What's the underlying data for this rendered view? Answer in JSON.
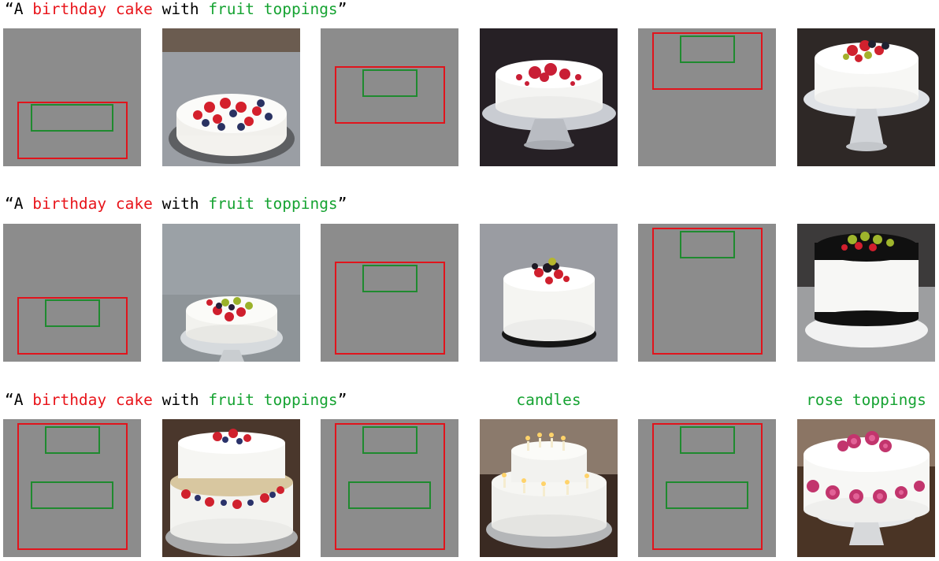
{
  "rows": [
    {
      "caption": {
        "q_open": "“A ",
        "bg": "birthday cake",
        "mid": " with ",
        "fg": "fruit toppings",
        "q_close": "”"
      },
      "labels": [
        "",
        ""
      ]
    },
    {
      "caption": {
        "q_open": "“A ",
        "bg": "birthday cake",
        "mid": " with ",
        "fg": "fruit toppings",
        "q_close": "”"
      },
      "labels": [
        "",
        ""
      ]
    },
    {
      "caption": {
        "q_open": "“A ",
        "bg": "birthday cake",
        "mid": " with ",
        "fg": "fruit toppings",
        "q_close": "”"
      },
      "labels": [
        "candles",
        "rose toppings"
      ]
    }
  ],
  "colors": {
    "background_text": "#e8141a",
    "foreground_text": "#16a332",
    "layout_background": "#8c8c8c",
    "red_box": "#e1141c",
    "green_box": "#1f8a2f"
  }
}
